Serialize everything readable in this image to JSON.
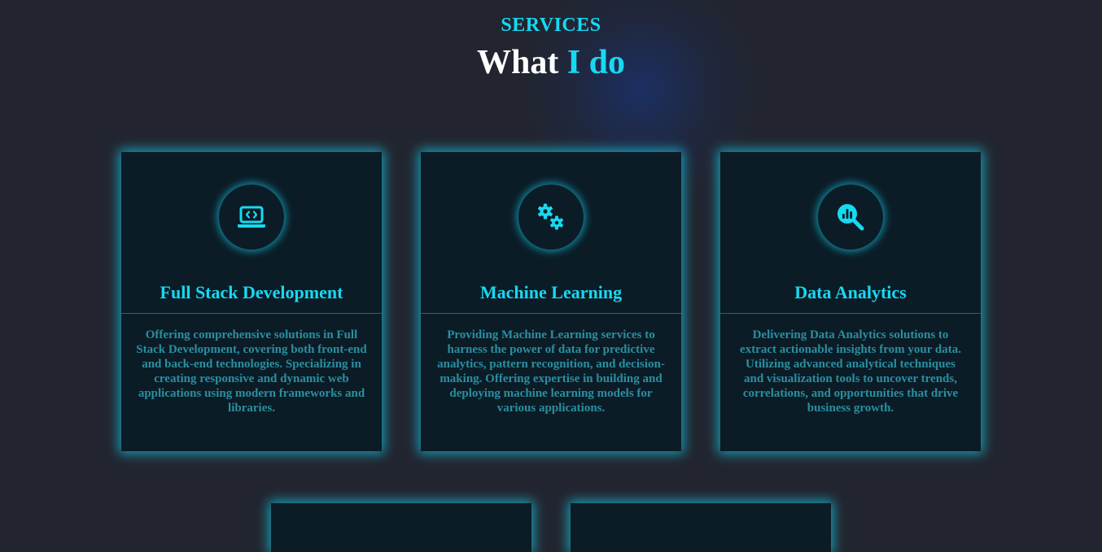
{
  "section": {
    "eyebrow": "SERVICES",
    "title_prefix": "What ",
    "title_accent": "I do"
  },
  "colors": {
    "background": "#22252f",
    "accent": "#17d9f2",
    "card_bg": "#0b1c26",
    "description": "#2a8fa0"
  },
  "services": [
    {
      "icon": "laptop-code-icon",
      "title": "Full Stack Development",
      "description": "Offering comprehensive solutions in Full Stack Development, covering both front-end and back-end technologies. Specializing in creating responsive and dynamic web applications using modern frameworks and libraries."
    },
    {
      "icon": "gears-icon",
      "title": "Machine Learning",
      "description": "Providing Machine Learning services to harness the power of data for predictive analytics, pattern recognition, and decision-making. Offering expertise in building and deploying machine learning models for various applications."
    },
    {
      "icon": "magnifying-glass-chart-icon",
      "title": "Data Analytics",
      "description": "Delivering Data Analytics solutions to extract actionable insights from your data. Utilizing advanced analytical techniques and visualization tools to uncover trends, correlations, and opportunities that drive business growth."
    }
  ]
}
